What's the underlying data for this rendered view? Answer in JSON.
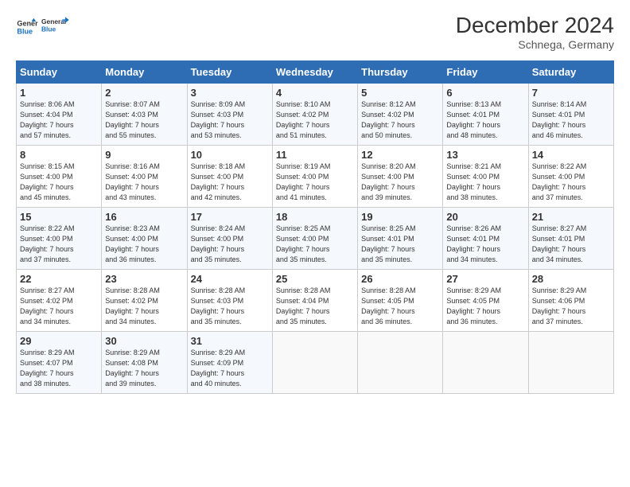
{
  "logo": {
    "line1": "General",
    "line2": "Blue"
  },
  "title": "December 2024",
  "subtitle": "Schnega, Germany",
  "days_header": [
    "Sunday",
    "Monday",
    "Tuesday",
    "Wednesday",
    "Thursday",
    "Friday",
    "Saturday"
  ],
  "weeks": [
    [
      {
        "day": "1",
        "sunrise": "8:06 AM",
        "sunset": "4:04 PM",
        "daylight": "7 hours and 57 minutes."
      },
      {
        "day": "2",
        "sunrise": "8:07 AM",
        "sunset": "4:03 PM",
        "daylight": "7 hours and 55 minutes."
      },
      {
        "day": "3",
        "sunrise": "8:09 AM",
        "sunset": "4:03 PM",
        "daylight": "7 hours and 53 minutes."
      },
      {
        "day": "4",
        "sunrise": "8:10 AM",
        "sunset": "4:02 PM",
        "daylight": "7 hours and 51 minutes."
      },
      {
        "day": "5",
        "sunrise": "8:12 AM",
        "sunset": "4:02 PM",
        "daylight": "7 hours and 50 minutes."
      },
      {
        "day": "6",
        "sunrise": "8:13 AM",
        "sunset": "4:01 PM",
        "daylight": "7 hours and 48 minutes."
      },
      {
        "day": "7",
        "sunrise": "8:14 AM",
        "sunset": "4:01 PM",
        "daylight": "7 hours and 46 minutes."
      }
    ],
    [
      {
        "day": "8",
        "sunrise": "8:15 AM",
        "sunset": "4:00 PM",
        "daylight": "7 hours and 45 minutes."
      },
      {
        "day": "9",
        "sunrise": "8:16 AM",
        "sunset": "4:00 PM",
        "daylight": "7 hours and 43 minutes."
      },
      {
        "day": "10",
        "sunrise": "8:18 AM",
        "sunset": "4:00 PM",
        "daylight": "7 hours and 42 minutes."
      },
      {
        "day": "11",
        "sunrise": "8:19 AM",
        "sunset": "4:00 PM",
        "daylight": "7 hours and 41 minutes."
      },
      {
        "day": "12",
        "sunrise": "8:20 AM",
        "sunset": "4:00 PM",
        "daylight": "7 hours and 39 minutes."
      },
      {
        "day": "13",
        "sunrise": "8:21 AM",
        "sunset": "4:00 PM",
        "daylight": "7 hours and 38 minutes."
      },
      {
        "day": "14",
        "sunrise": "8:22 AM",
        "sunset": "4:00 PM",
        "daylight": "7 hours and 37 minutes."
      }
    ],
    [
      {
        "day": "15",
        "sunrise": "8:22 AM",
        "sunset": "4:00 PM",
        "daylight": "7 hours and 37 minutes."
      },
      {
        "day": "16",
        "sunrise": "8:23 AM",
        "sunset": "4:00 PM",
        "daylight": "7 hours and 36 minutes."
      },
      {
        "day": "17",
        "sunrise": "8:24 AM",
        "sunset": "4:00 PM",
        "daylight": "7 hours and 35 minutes."
      },
      {
        "day": "18",
        "sunrise": "8:25 AM",
        "sunset": "4:00 PM",
        "daylight": "7 hours and 35 minutes."
      },
      {
        "day": "19",
        "sunrise": "8:25 AM",
        "sunset": "4:01 PM",
        "daylight": "7 hours and 35 minutes."
      },
      {
        "day": "20",
        "sunrise": "8:26 AM",
        "sunset": "4:01 PM",
        "daylight": "7 hours and 34 minutes."
      },
      {
        "day": "21",
        "sunrise": "8:27 AM",
        "sunset": "4:01 PM",
        "daylight": "7 hours and 34 minutes."
      }
    ],
    [
      {
        "day": "22",
        "sunrise": "8:27 AM",
        "sunset": "4:02 PM",
        "daylight": "7 hours and 34 minutes."
      },
      {
        "day": "23",
        "sunrise": "8:28 AM",
        "sunset": "4:02 PM",
        "daylight": "7 hours and 34 minutes."
      },
      {
        "day": "24",
        "sunrise": "8:28 AM",
        "sunset": "4:03 PM",
        "daylight": "7 hours and 35 minutes."
      },
      {
        "day": "25",
        "sunrise": "8:28 AM",
        "sunset": "4:04 PM",
        "daylight": "7 hours and 35 minutes."
      },
      {
        "day": "26",
        "sunrise": "8:28 AM",
        "sunset": "4:05 PM",
        "daylight": "7 hours and 36 minutes."
      },
      {
        "day": "27",
        "sunrise": "8:29 AM",
        "sunset": "4:05 PM",
        "daylight": "7 hours and 36 minutes."
      },
      {
        "day": "28",
        "sunrise": "8:29 AM",
        "sunset": "4:06 PM",
        "daylight": "7 hours and 37 minutes."
      }
    ],
    [
      {
        "day": "29",
        "sunrise": "8:29 AM",
        "sunset": "4:07 PM",
        "daylight": "7 hours and 38 minutes."
      },
      {
        "day": "30",
        "sunrise": "8:29 AM",
        "sunset": "4:08 PM",
        "daylight": "7 hours and 39 minutes."
      },
      {
        "day": "31",
        "sunrise": "8:29 AM",
        "sunset": "4:09 PM",
        "daylight": "7 hours and 40 minutes."
      },
      null,
      null,
      null,
      null
    ]
  ],
  "labels": {
    "sunrise": "Sunrise:",
    "sunset": "Sunset:",
    "daylight": "Daylight:"
  }
}
